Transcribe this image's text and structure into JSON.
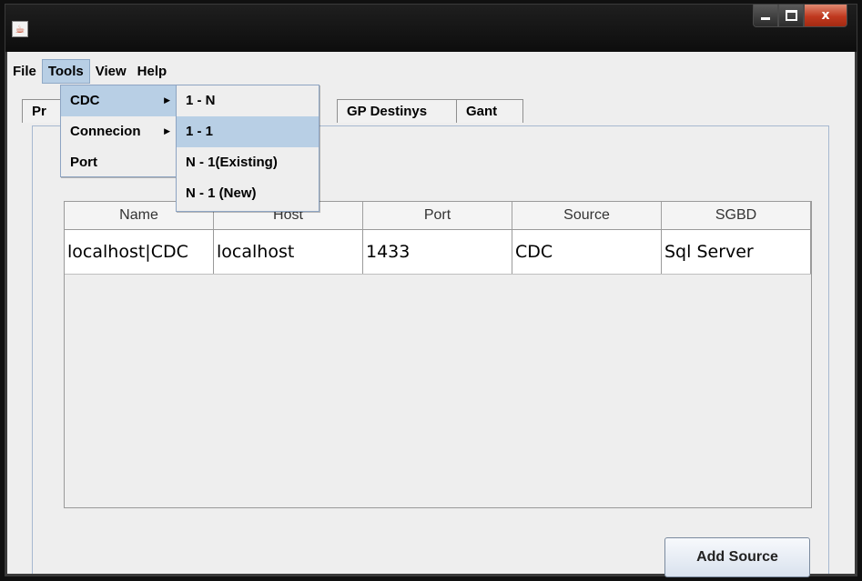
{
  "window": {
    "icon": "java-icon",
    "minimize_icon": "minimize-icon",
    "maximize_icon": "maximize-icon",
    "close_glyph": "x"
  },
  "menubar": {
    "file": "File",
    "tools": "Tools",
    "view": "View",
    "help": "Help"
  },
  "tabs": {
    "partial": "Pr",
    "gp_destinys": "GP Destinys",
    "gant": "Gant"
  },
  "tools_menu": {
    "items": [
      "CDC",
      "Connecion",
      "Port"
    ],
    "arrow": "▶"
  },
  "cdc_submenu": {
    "items": [
      "1 - N",
      "1 - 1",
      "N - 1(Existing)",
      "N - 1 (New)"
    ],
    "selected": "1 - 1"
  },
  "table": {
    "columns": [
      "Name",
      "Host",
      "Port",
      "Source",
      "SGBD"
    ],
    "rows": [
      [
        "localhost|CDC",
        "localhost",
        "1433",
        "CDC",
        "Sql Server"
      ]
    ]
  },
  "buttons": {
    "add_source": "Add Source"
  },
  "colors": {
    "selection": "#b8cfe5",
    "accent_border": "#8da4c2",
    "close_button": "#c0391f"
  }
}
